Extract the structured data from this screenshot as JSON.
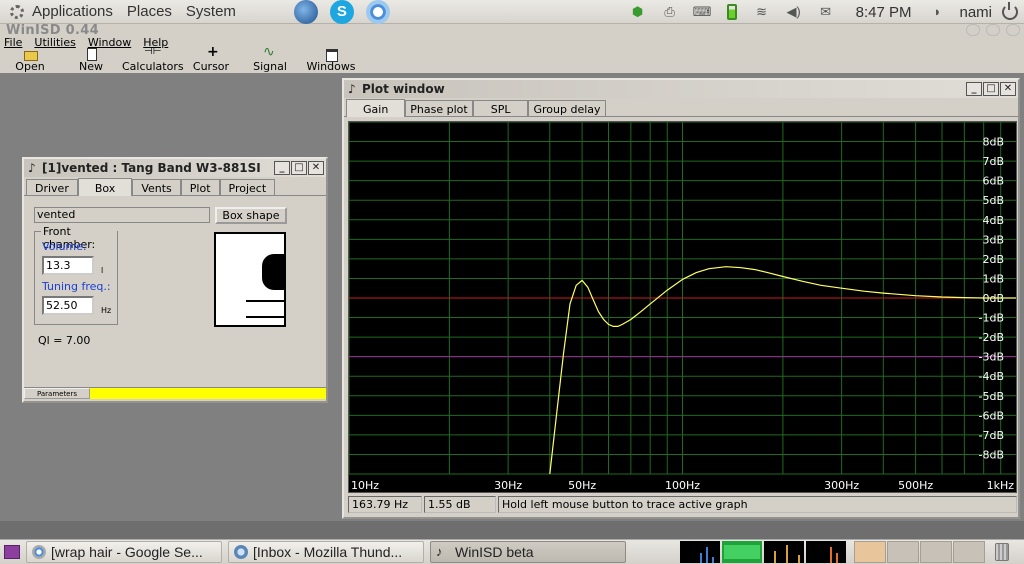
{
  "top_panel": {
    "menus": [
      "Applications",
      "Places",
      "System"
    ],
    "clock": "8:47 PM",
    "user": "nami"
  },
  "app": {
    "title": "WinISD 0.44",
    "menu": [
      "File",
      "Utilities",
      "Window",
      "Help"
    ],
    "toolbar": [
      {
        "label": "Open",
        "icon": "open-folder-icon"
      },
      {
        "label": "New",
        "icon": "new-document-icon"
      },
      {
        "label": "Calculators",
        "icon": "calculator-icon"
      },
      {
        "label": "Cursor",
        "icon": "cursor-crosshair-icon"
      },
      {
        "label": "Signal gen.",
        "icon": "signal-generator-icon"
      },
      {
        "label": "Windows",
        "icon": "windows-icon"
      }
    ]
  },
  "box_window": {
    "title": "[1]vented : Tang Band W3-881SI",
    "tabs": [
      "Driver",
      "Box",
      "Vents",
      "Plot",
      "Project"
    ],
    "active_tab": "Box",
    "box_type": "vented",
    "box_shape_label": "Box shape",
    "front_chamber_label": "Front chamber:",
    "volume_label": "Volume:",
    "volume_value": "13.3",
    "volume_unit": "l",
    "tuning_label": "Tuning freq.:",
    "tuning_value": "52.50",
    "tuning_unit": "Hz",
    "ql_text": "Ql = 7.00",
    "status_label": "Parameters",
    "status_color": "#ffff00"
  },
  "plot_window": {
    "title": "Plot window",
    "tabs": [
      "Gain",
      "Phase plot",
      "SPL",
      "Group delay"
    ],
    "active_tab": "Gain",
    "status": {
      "frequency": "163.79 Hz",
      "level": "1.55 dB",
      "hint": "Hold left mouse button to trace active graph"
    }
  },
  "chart_data": {
    "type": "line",
    "title": "",
    "xlabel": "",
    "ylabel": "",
    "x_scale": "log",
    "xlim": [
      10,
      1000
    ],
    "ylim": [
      -9,
      9
    ],
    "x_tick_labels": [
      {
        "value": 10,
        "label": "10Hz"
      },
      {
        "value": 30,
        "label": "30Hz"
      },
      {
        "value": 50,
        "label": "50Hz"
      },
      {
        "value": 100,
        "label": "100Hz"
      },
      {
        "value": 300,
        "label": "300Hz"
      },
      {
        "value": 500,
        "label": "500Hz"
      },
      {
        "value": 1000,
        "label": "1kHz"
      }
    ],
    "y_tick_labels": [
      "8dB",
      "7dB",
      "6dB",
      "5dB",
      "4dB",
      "3dB",
      "2dB",
      "1dB",
      "0dB",
      "-1dB",
      "-2dB",
      "-3dB",
      "-4dB",
      "-5dB",
      "-6dB",
      "-7dB",
      "-8dB"
    ],
    "y_tick_values": [
      8,
      7,
      6,
      5,
      4,
      3,
      2,
      1,
      0,
      -1,
      -2,
      -3,
      -4,
      -5,
      -6,
      -7,
      -8
    ],
    "grid": true,
    "background": "#000000",
    "grid_color": "#1f6b1f",
    "reference_lines": [
      {
        "y": 0,
        "color": "#c81e1e"
      },
      {
        "y": -3,
        "color": "#9a2a9a"
      }
    ],
    "series": [
      {
        "color": "#ffff66",
        "x": [
          40,
          42,
          44,
          46,
          48,
          50,
          52,
          54,
          56,
          58,
          60,
          62,
          64,
          66,
          70,
          75,
          80,
          90,
          100,
          110,
          120,
          135,
          150,
          165,
          180,
          200,
          230,
          260,
          300,
          350,
          400,
          500,
          600,
          700,
          800,
          900,
          1000
        ],
        "y": [
          -9.0,
          -5.8,
          -2.8,
          -0.3,
          0.65,
          0.9,
          0.55,
          -0.1,
          -0.7,
          -1.1,
          -1.35,
          -1.45,
          -1.45,
          -1.35,
          -1.1,
          -0.7,
          -0.3,
          0.4,
          0.95,
          1.3,
          1.5,
          1.6,
          1.55,
          1.45,
          1.3,
          1.1,
          0.85,
          0.65,
          0.5,
          0.35,
          0.25,
          0.12,
          0.05,
          0.02,
          0.0,
          0.0,
          0.0
        ]
      }
    ]
  },
  "bottom_panel": {
    "tasks": [
      {
        "label": "[wrap hair - Google Se...",
        "icon": "chrome-icon"
      },
      {
        "label": "[Inbox - Mozilla Thund...",
        "icon": "thunderbird-icon"
      },
      {
        "label": "WinISD beta",
        "icon": "winisd-icon"
      }
    ]
  }
}
